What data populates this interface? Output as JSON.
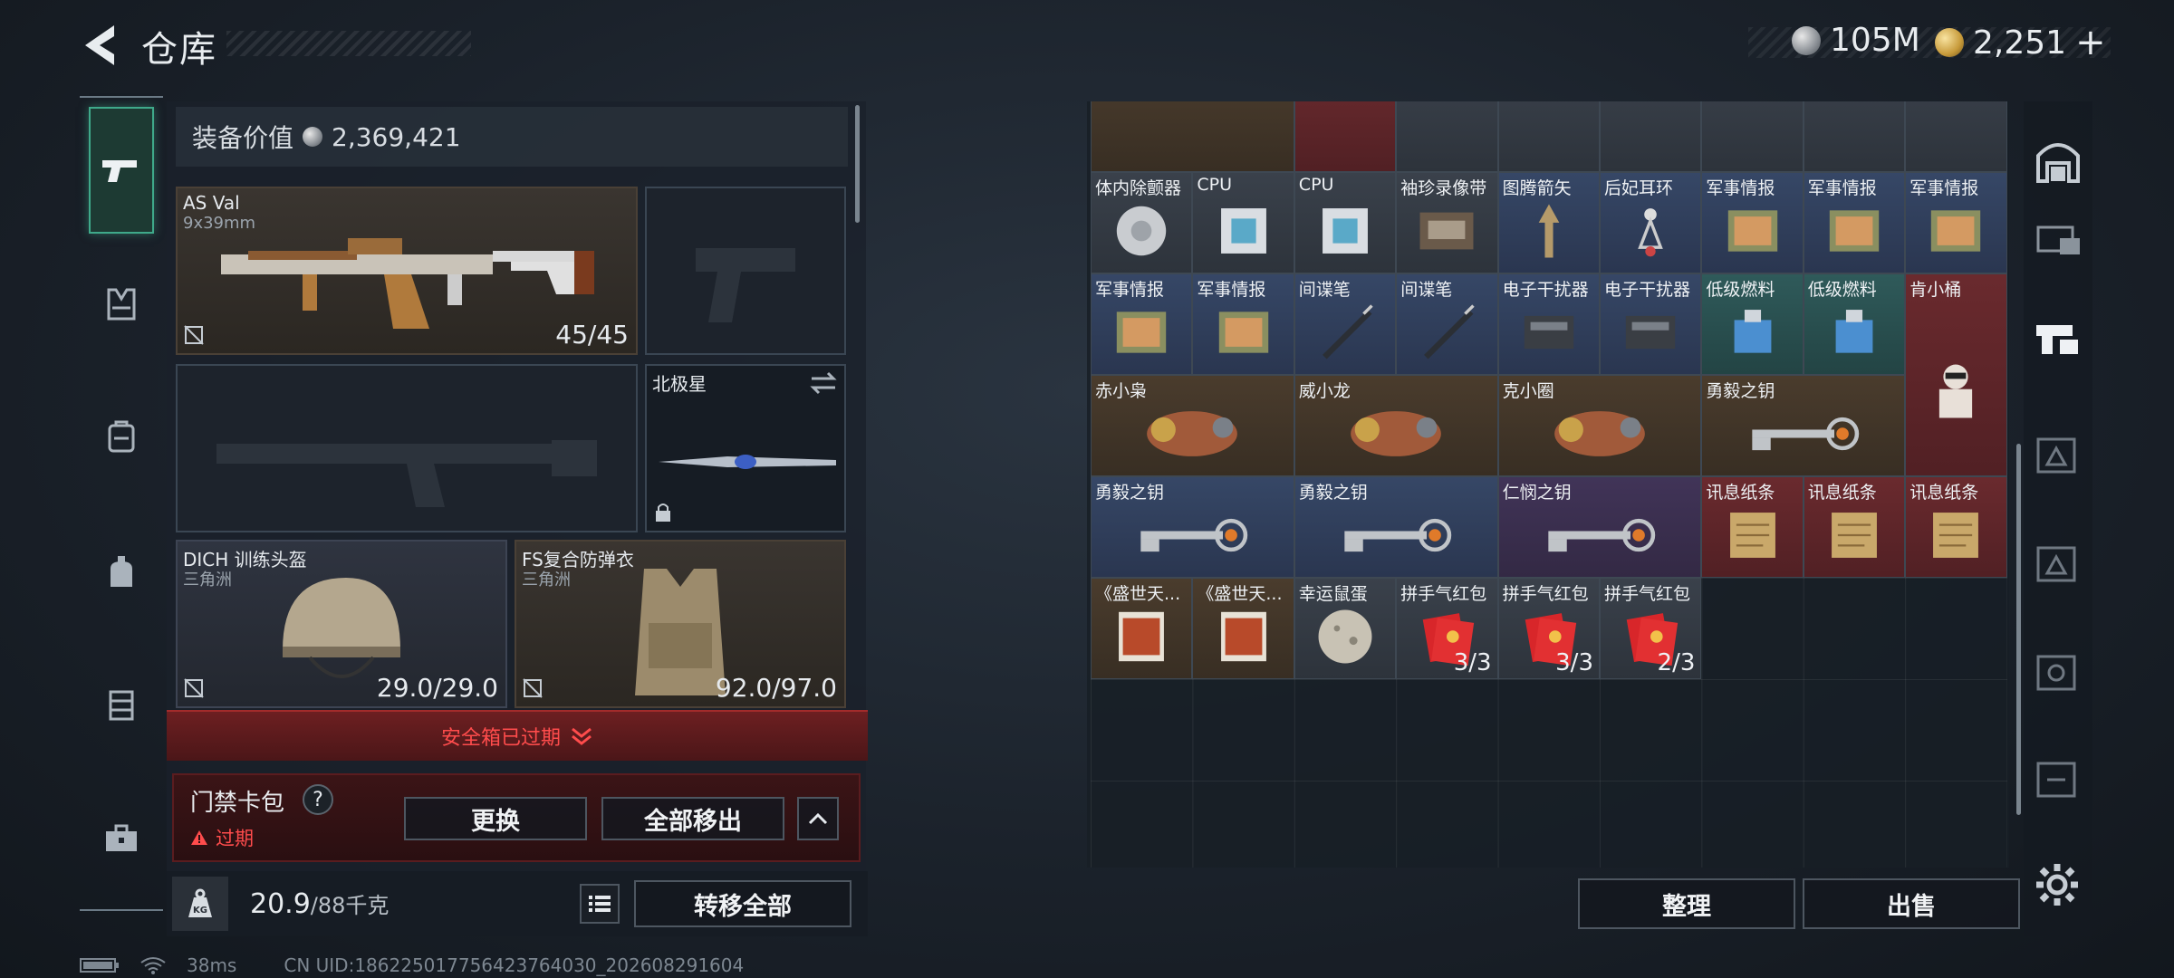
{
  "header": {
    "title": "仓库"
  },
  "currency": {
    "silver": "105M",
    "gold": "2,251",
    "plus": "+"
  },
  "equipment": {
    "value_label": "装备价值",
    "value": "2,369,421",
    "primary": {
      "name": "AS Val",
      "caliber": "9x39mm",
      "ammo": "45/45"
    },
    "melee": {
      "name": "北极星"
    },
    "helmet": {
      "name": "DICH 训练头盔",
      "brand": "三角洲",
      "durability": "29.0/29.0"
    },
    "armor": {
      "name": "FS复合防弹衣",
      "brand": "三角洲",
      "durability": "92.0/97.0"
    },
    "safe_box_expired": "安全箱已过期",
    "key_card": {
      "label": "门禁卡包",
      "help": "?",
      "status": "过期",
      "replace": "更换",
      "remove_all": "全部移出"
    },
    "weight": {
      "value": "20.9",
      "unit": "/88千克"
    },
    "transfer_all": "转移全部"
  },
  "stash": {
    "items": [
      {
        "label": "体内除颤器"
      },
      {
        "label": "CPU"
      },
      {
        "label": "CPU"
      },
      {
        "label": "袖珍录像带"
      },
      {
        "label": "图腾箭矢"
      },
      {
        "label": "后妃耳环"
      },
      {
        "label": "军事情报"
      },
      {
        "label": "军事情报"
      },
      {
        "label": "军事情报"
      },
      {
        "label": "军事情报"
      },
      {
        "label": "军事情报"
      },
      {
        "label": "间谍笔"
      },
      {
        "label": "间谍笔"
      },
      {
        "label": "电子干扰器"
      },
      {
        "label": "电子干扰器"
      },
      {
        "label": "低级燃料"
      },
      {
        "label": "低级燃料"
      },
      {
        "label": "肯小桶"
      },
      {
        "label": "赤小枭"
      },
      {
        "label": "威小龙"
      },
      {
        "label": "克小圈"
      },
      {
        "label": "勇毅之钥"
      },
      {
        "label": "勇毅之钥"
      },
      {
        "label": "勇毅之钥"
      },
      {
        "label": "仁悯之钥"
      },
      {
        "label": "讯息纸条"
      },
      {
        "label": "讯息纸条"
      },
      {
        "label": "讯息纸条"
      },
      {
        "label": "《盛世天..."
      },
      {
        "label": "《盛世天..."
      },
      {
        "label": "幸运鼠蛋"
      },
      {
        "label": "拼手气红包",
        "count": "3/3"
      },
      {
        "label": "拼手气红包",
        "count": "3/3"
      },
      {
        "label": "拼手气红包",
        "count": "2/3"
      }
    ],
    "sort": "整理",
    "sell": "出售"
  },
  "footer": {
    "ping": "38ms",
    "uid": "CN UID:1862250177564237640​30_202608291604"
  },
  "colors": {
    "accent": "#3fa98a",
    "danger": "#ff4c4c"
  }
}
